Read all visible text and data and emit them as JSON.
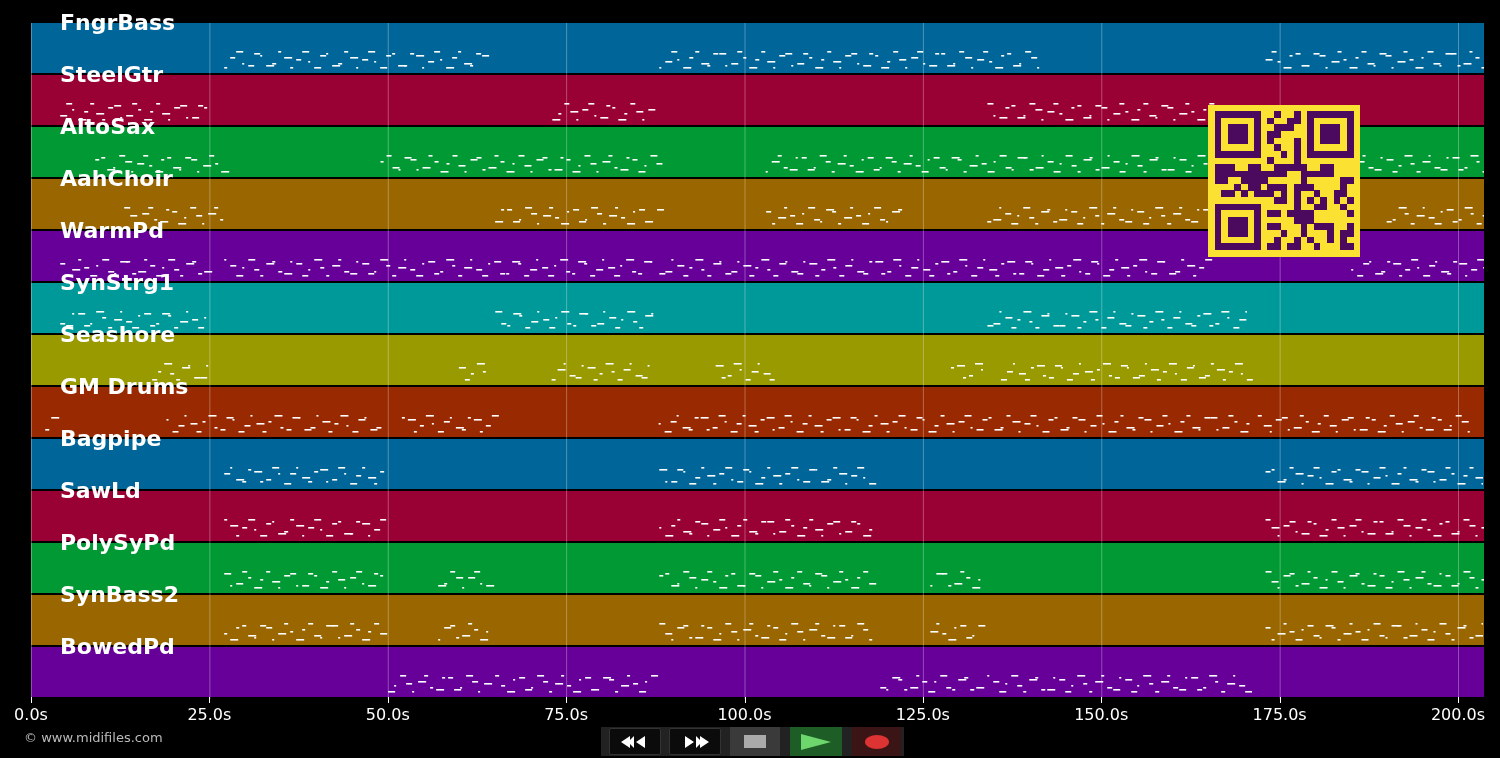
{
  "tracks": [
    {
      "name": "FngrBass",
      "color": "#006699"
    },
    {
      "name": "SteelGtr",
      "color": "#990033"
    },
    {
      "name": "AltoSax",
      "color": "#009933"
    },
    {
      "name": "AahChoir",
      "color": "#996600"
    },
    {
      "name": "WarmPd",
      "color": "#660099"
    },
    {
      "name": "SynStrg1",
      "color": "#009999"
    },
    {
      "name": "Seashore",
      "color": "#999900"
    },
    {
      "name": "GM Drums",
      "color": "#992900"
    },
    {
      "name": "Bagpipe",
      "color": "#006699"
    },
    {
      "name": "SawLd",
      "color": "#990033"
    },
    {
      "name": "PolySyPd",
      "color": "#009933"
    },
    {
      "name": "SynBass2",
      "color": "#996600"
    },
    {
      "name": "BowedPd",
      "color": "#660099"
    }
  ],
  "axis": {
    "ticks": [
      "0.0s",
      "25.0s",
      "50.0s",
      "75.0s",
      "100.0s",
      "125.0s",
      "150.0s",
      "175.0s",
      "200.0s"
    ]
  },
  "credit": "© www.midifiles.com",
  "transport": [
    {
      "kind": "rewind"
    },
    {
      "kind": "forward"
    },
    {
      "kind": "stop"
    },
    {
      "kind": "play"
    },
    {
      "kind": "record"
    }
  ]
}
